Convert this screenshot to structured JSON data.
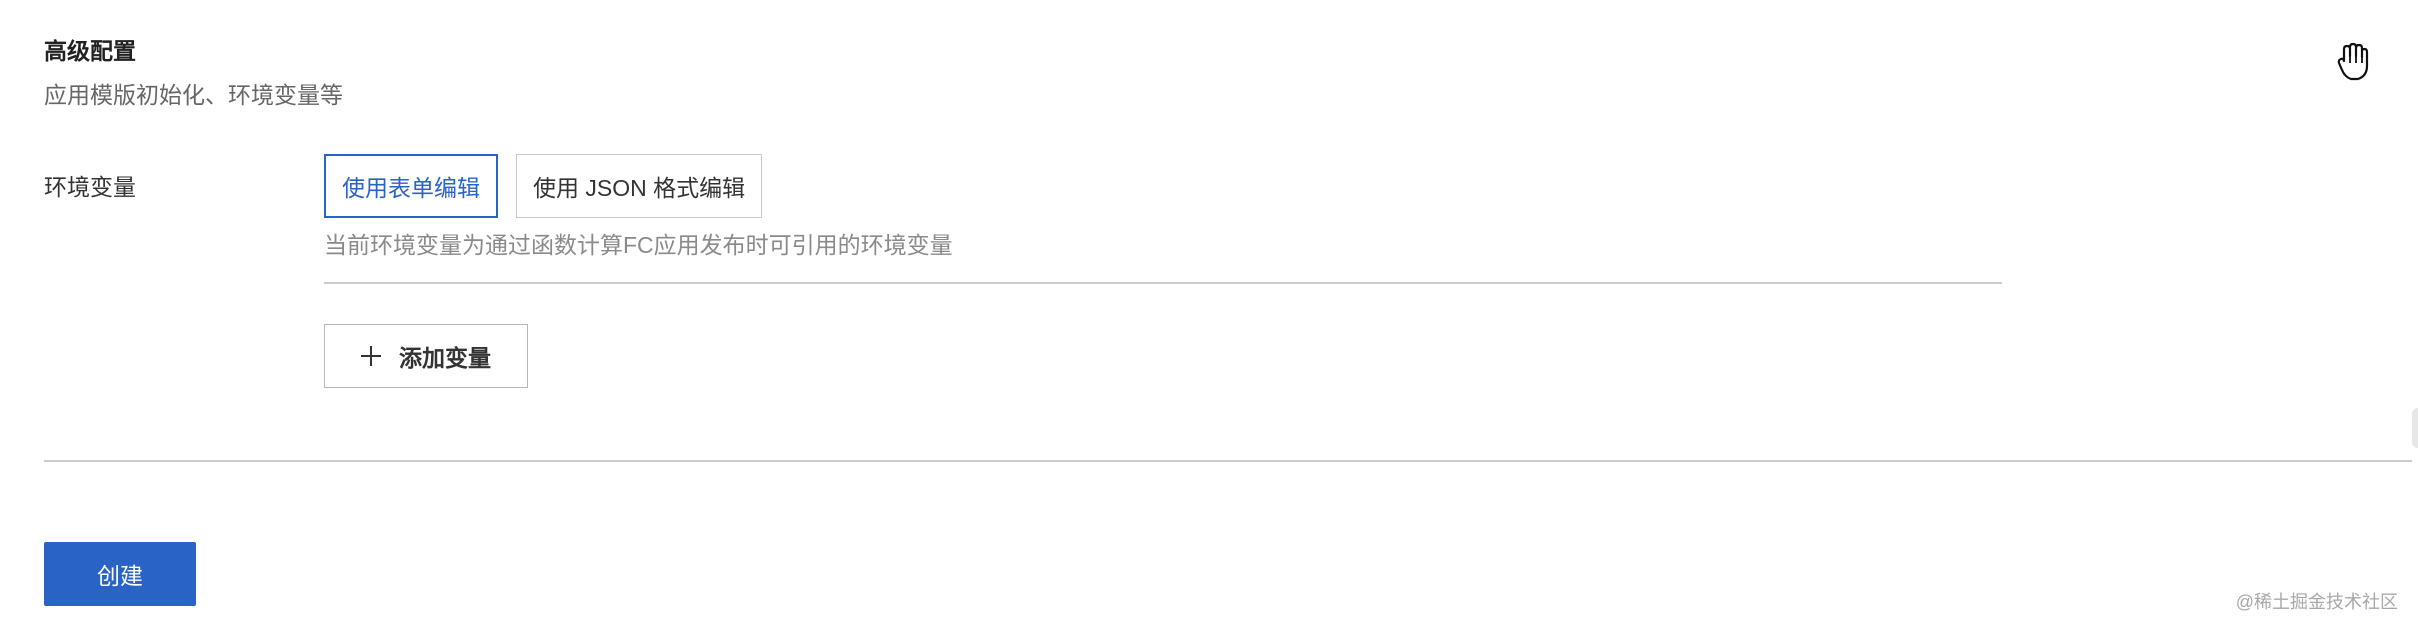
{
  "section": {
    "title": "高级配置",
    "subtitle": "应用模版初始化、环境变量等"
  },
  "env": {
    "label": "环境变量",
    "modes": {
      "form": "使用表单编辑",
      "json": "使用 JSON 格式编辑"
    },
    "helper": "当前环境变量为通过函数计算FC应用发布时可引用的环境变量",
    "add_label": "添加变量"
  },
  "actions": {
    "create_label": "创建"
  },
  "watermark": "@稀土掘金技术社区",
  "icons": {
    "cursor": "hand-pointer-icon",
    "add": "plus-icon"
  },
  "colors": {
    "accent": "#2a63c6",
    "text": "#333333",
    "muted": "#8a8a8a"
  }
}
